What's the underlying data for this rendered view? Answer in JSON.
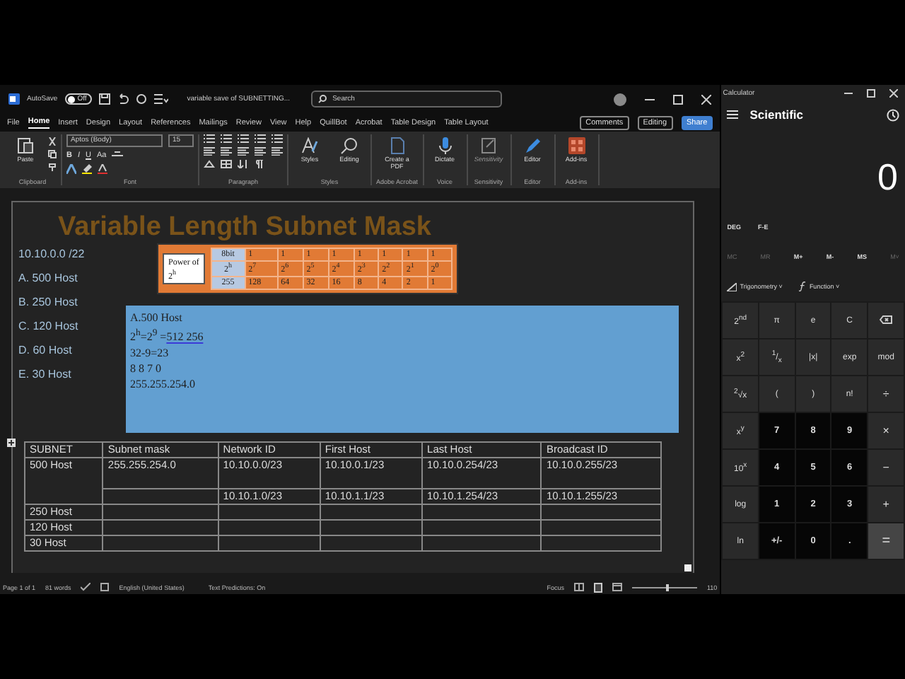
{
  "word": {
    "autosave": {
      "label": "AutoSave",
      "state_text": "Off",
      "on": false
    },
    "doc_title": "variable save of SUBNETTING...",
    "search": {
      "placeholder": "Search"
    },
    "tabs": [
      {
        "label": "File",
        "selected": false
      },
      {
        "label": "Home",
        "selected": true
      },
      {
        "label": "Insert",
        "selected": false
      },
      {
        "label": "Design",
        "selected": false
      },
      {
        "label": "Layout",
        "selected": false
      },
      {
        "label": "References",
        "selected": false
      },
      {
        "label": "Mailings",
        "selected": false
      },
      {
        "label": "Review",
        "selected": false
      },
      {
        "label": "View",
        "selected": false
      },
      {
        "label": "Help",
        "selected": false
      },
      {
        "label": "QuillBot",
        "selected": false
      },
      {
        "label": "Acrobat",
        "selected": false
      },
      {
        "label": "Table Design",
        "selected": false
      },
      {
        "label": "Table Layout",
        "selected": false
      }
    ],
    "actions": [
      {
        "label": "Comments",
        "kind": "comments"
      },
      {
        "label": "Editing",
        "kind": "editing"
      },
      {
        "label": "Share",
        "kind": "share"
      }
    ],
    "ribbon": [
      {
        "name": "Clipboard",
        "kind": "clipboard",
        "buttons": [
          {
            "label": "Paste",
            "disabled": false
          }
        ]
      },
      {
        "name": "Font",
        "kind": "font",
        "font": "Aptos (Body)",
        "size": "15",
        "format": [
          "B",
          "I",
          "U",
          "Aa"
        ]
      },
      {
        "name": "Paragraph",
        "kind": "paragraph"
      },
      {
        "name": "Styles",
        "kind": "big",
        "buttons": [
          {
            "label": "Styles",
            "kind": "styles",
            "disabled": false
          },
          {
            "label": "Editing",
            "kind": "find",
            "disabled": false
          }
        ]
      },
      {
        "name": "Adobe Acrobat",
        "kind": "big",
        "buttons": [
          {
            "label": "Create a PDF",
            "kind": "pdf",
            "disabled": false
          }
        ]
      },
      {
        "name": "Voice",
        "kind": "big",
        "buttons": [
          {
            "label": "Dictate",
            "kind": "mic",
            "disabled": false
          }
        ]
      },
      {
        "name": "Sensitivity",
        "kind": "big",
        "buttons": [
          {
            "label": "Sensitivity",
            "kind": "sensitivity",
            "disabled": true
          }
        ]
      },
      {
        "name": "Editor",
        "kind": "big",
        "buttons": [
          {
            "label": "Editor",
            "kind": "editor",
            "disabled": false
          }
        ]
      },
      {
        "name": "Add-ins",
        "kind": "big",
        "buttons": [
          {
            "label": "Add-ins",
            "kind": "addins",
            "disabled": false
          }
        ]
      }
    ]
  },
  "document": {
    "title": "Variable Length Subnet Mask",
    "notes": [
      "10.10.0.0 /22",
      "A. 500 Host",
      "B. 250 Host",
      "C. 120 Host",
      "D. 60 Host",
      "E. 30 Host"
    ],
    "power_table": {
      "label": "Power of 2$^{h}$",
      "rows": [
        [
          "8bit",
          "1",
          "1",
          "1",
          "1",
          "1",
          "1",
          "1",
          "1"
        ],
        [
          "2$^{h}$",
          "2$^{7}$",
          "2$^{6}$",
          "2$^{5}$",
          "2$^{4}$",
          "2$^{3}$",
          "2$^{2}$",
          "2$^{1}$",
          "2$^{0}$"
        ],
        [
          "255",
          "128",
          "64",
          "32",
          "16",
          "8",
          "4",
          "2",
          "1"
        ]
      ]
    },
    "working": [
      {
        "text": "A.500 Host"
      },
      {
        "text": "2$^{h}$=2$^{9}$ =",
        "flagged": "512  256"
      },
      {
        "text": "32-9=23"
      },
      {
        "text": "8 8 7 0"
      },
      {
        "text": "255.255.254.0"
      }
    ],
    "table": {
      "columns": [
        "SUBNET",
        "Subnet mask",
        "Network ID",
        "First Host",
        "Last Host",
        "Broadcast ID"
      ],
      "rows": [
        {
          "subnet": "500 Host",
          "mask": "255.255.254.0",
          "ranges": [
            {
              "network": "10.10.0.0/23",
              "first": "10.10.0.1/23",
              "last": "10.10.0.254/23",
              "broadcast": "10.10.0.255/23"
            },
            {
              "network": "10.10.1.0/23",
              "first": "10.10.1.1/23",
              "last": "10.10.1.254/23",
              "broadcast": "10.10.1.255/23"
            }
          ]
        },
        {
          "subnet": "250 Host"
        },
        {
          "subnet": "120 Host"
        },
        {
          "subnet": "30 Host"
        }
      ]
    }
  },
  "status_bar": {
    "page": "Page 1 of 1",
    "words": "81 words",
    "language": "English (United States)",
    "predictions": "Text Predictions: On",
    "focus": "Focus",
    "zoom": {
      "level": 0.55
    },
    "zoom_text": "110"
  },
  "calculator": {
    "title": "Calculator",
    "mode": "Scientific",
    "display": "0",
    "angle": "DEG",
    "notation": "F-E",
    "memory": [
      {
        "label": "MC",
        "disabled": true
      },
      {
        "label": "MR",
        "disabled": true
      },
      {
        "label": "M+",
        "disabled": false
      },
      {
        "label": "M-",
        "disabled": false
      },
      {
        "label": "MS",
        "disabled": false
      },
      {
        "label": "M˅",
        "disabled": true
      }
    ],
    "menus": [
      {
        "label": "Trigonometry",
        "kind": "trig",
        "caret": "˅"
      },
      {
        "label": "Function",
        "kind": "func",
        "caret": "˅"
      }
    ],
    "keys": [
      {
        "label": "2$^{nd}$",
        "kind": "fn"
      },
      {
        "label": "π",
        "kind": "fn"
      },
      {
        "label": "e",
        "kind": "fn"
      },
      {
        "label": "C",
        "kind": "fn"
      },
      {
        "kind": "backspace"
      },
      {
        "label": "x$^{2}$",
        "kind": "fn"
      },
      {
        "label": "$^{1}$/$_{x}$",
        "kind": "fn"
      },
      {
        "label": "|x|",
        "kind": "fn"
      },
      {
        "label": "exp",
        "kind": "fn"
      },
      {
        "label": "mod",
        "kind": "fn"
      },
      {
        "label": "$^{2}$√x",
        "kind": "fn"
      },
      {
        "label": "(",
        "kind": "fn"
      },
      {
        "label": ")",
        "kind": "fn"
      },
      {
        "label": "n!",
        "kind": "fn"
      },
      {
        "label": "÷",
        "kind": "op"
      },
      {
        "label": "x$^{y}$",
        "kind": "fn"
      },
      {
        "label": "7",
        "kind": "digit"
      },
      {
        "label": "8",
        "kind": "digit"
      },
      {
        "label": "9",
        "kind": "digit"
      },
      {
        "label": "×",
        "kind": "op"
      },
      {
        "label": "10$^{x}$",
        "kind": "fn"
      },
      {
        "label": "4",
        "kind": "digit"
      },
      {
        "label": "5",
        "kind": "digit"
      },
      {
        "label": "6",
        "kind": "digit"
      },
      {
        "label": "−",
        "kind": "op"
      },
      {
        "label": "log",
        "kind": "fn"
      },
      {
        "label": "1",
        "kind": "digit"
      },
      {
        "label": "2",
        "kind": "digit"
      },
      {
        "label": "3",
        "kind": "digit"
      },
      {
        "label": "+",
        "kind": "op"
      },
      {
        "label": "ln",
        "kind": "fn"
      },
      {
        "label": "+/-",
        "kind": "digit"
      },
      {
        "label": "0",
        "kind": "digit"
      },
      {
        "label": ".",
        "kind": "digit"
      },
      {
        "label": "=",
        "kind": "equals"
      }
    ]
  }
}
